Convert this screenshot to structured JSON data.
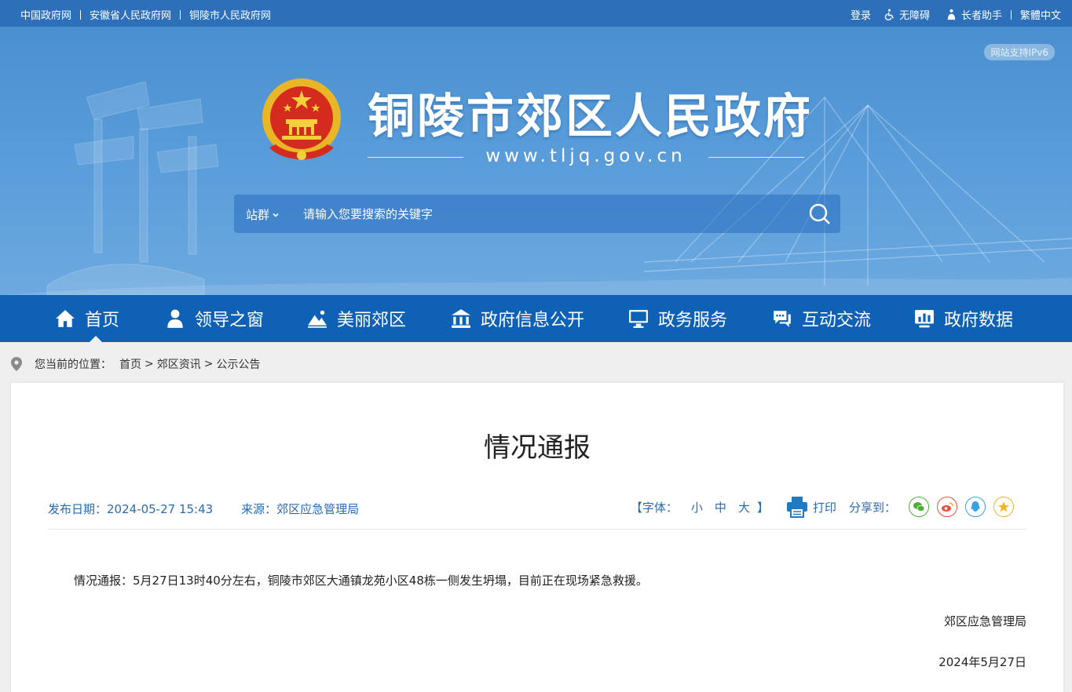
{
  "topbar": {
    "links": [
      "中国政府网",
      "安徽省人民政府网",
      "铜陵市人民政府网"
    ],
    "login": "登录",
    "accessibility": "无障碍",
    "elder_mode": "长者助手",
    "traditional": "繁體中文"
  },
  "banner": {
    "ipv6": "网站支持IPv6",
    "title": "铜陵市郊区人民政府",
    "domain": "www.tljq.gov.cn"
  },
  "search": {
    "scope": "站群",
    "placeholder": "请输入您要搜索的关键字"
  },
  "nav": {
    "items": [
      {
        "label": "首页",
        "icon": "home-icon"
      },
      {
        "label": "领导之窗",
        "icon": "person-icon"
      },
      {
        "label": "美丽郊区",
        "icon": "landscape-icon"
      },
      {
        "label": "政府信息公开",
        "icon": "government-building-icon"
      },
      {
        "label": "政务服务",
        "icon": "monitor-icon"
      },
      {
        "label": "互动交流",
        "icon": "chat-icon"
      },
      {
        "label": "政府数据",
        "icon": "data-chart-icon"
      }
    ]
  },
  "breadcrumb": {
    "prefix": "您当前的位置：",
    "items": [
      "首页",
      "郊区资讯",
      "公示公告"
    ]
  },
  "article": {
    "title": "情况通报",
    "date_label": "发布日期：2024-05-27 15:43",
    "source_label": "来源：郊区应急管理局",
    "font_label": "【字体：",
    "font_small": "小",
    "font_medium": "中",
    "font_large": "大",
    "font_close": "】",
    "print": "打印",
    "share_label": "分享到：",
    "share_icons": [
      "wechat-icon",
      "weibo-icon",
      "qq-icon",
      "qzone-icon"
    ],
    "body": "情况通报：5月27日13时40分左右，铜陵市郊区大通镇龙苑小区48栋一侧发生坍塌，目前正在现场紧急救援。",
    "signature": "郊区应急管理局",
    "sign_date": "2024年5月27日"
  },
  "colors": {
    "topbar": "#2d6fb8",
    "nav": "#0f61b6",
    "accent_text": "#2a6bb0"
  }
}
